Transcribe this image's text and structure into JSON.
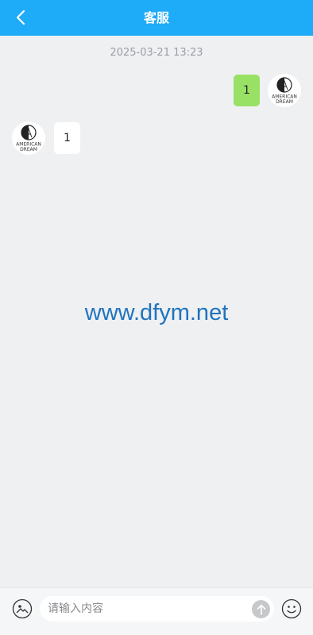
{
  "header": {
    "title": "客服",
    "back_icon": "chevron-left-icon"
  },
  "chat": {
    "timestamp": "2025-03-21 13:23",
    "messages": [
      {
        "direction": "sent",
        "text": "1",
        "avatar_text": "AMERICAN DREAM"
      },
      {
        "direction": "received",
        "text": "1",
        "avatar_text": "AMERICAN DREAM"
      }
    ]
  },
  "watermark": "www.dfym.net",
  "input_bar": {
    "placeholder": "请输入内容",
    "image_icon": "image-icon",
    "send_icon": "arrow-up-icon",
    "emoji_icon": "smiley-icon"
  },
  "colors": {
    "header_bg": "#1eabf7",
    "sent_bubble": "#98e165",
    "received_bubble": "#ffffff",
    "page_bg": "#eff0f2",
    "watermark": "#1f74bd"
  }
}
